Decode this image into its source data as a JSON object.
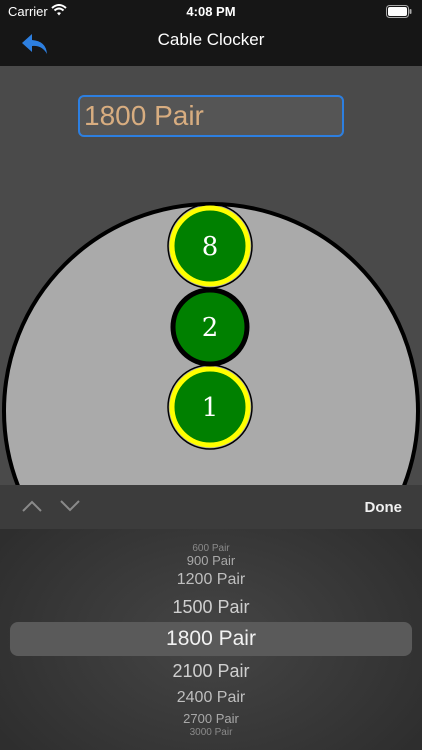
{
  "status_bar": {
    "carrier": "Carrier",
    "time": "4:08 PM"
  },
  "nav": {
    "title": "Cable Clocker",
    "back_icon": "back-arrow-icon",
    "accent_color": "#2d7fe0"
  },
  "pair_field": {
    "value": "1800 Pair"
  },
  "cable": {
    "circles": [
      {
        "label": "8",
        "fill": "#008000",
        "ring": "#ffff00"
      },
      {
        "label": "2",
        "fill": "#008000",
        "ring": "#000000"
      },
      {
        "label": "1",
        "fill": "#008000",
        "ring": "#ffff00"
      }
    ]
  },
  "picker_toolbar": {
    "done_label": "Done",
    "up_icon": "chevron-up-icon",
    "down_icon": "chevron-down-icon"
  },
  "picker": {
    "options": [
      "600 Pair",
      "900 Pair",
      "1200 Pair",
      "1500 Pair",
      "1800 Pair",
      "2100 Pair",
      "2400 Pair",
      "2700 Pair",
      "3000 Pair"
    ],
    "selected": "1800 Pair"
  }
}
